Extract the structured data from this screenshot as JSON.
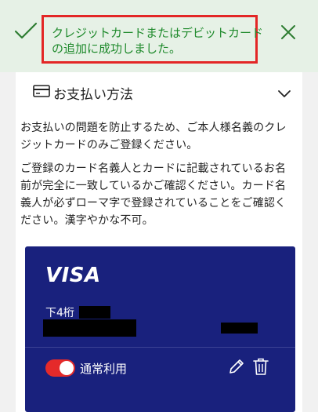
{
  "banner": {
    "line1": "クレジットカードまたはデビットカード",
    "line2": "の追加に成功しました。",
    "icons": {
      "status": "check-icon",
      "dismiss": "close-icon"
    },
    "colors": {
      "background": "#e6f1e6",
      "text": "#1f8a2c",
      "highlight_border": "#e32626"
    }
  },
  "payment": {
    "title": "お支払い方法",
    "icons": {
      "leading": "credit-card-icon",
      "toggle": "chevron-down-icon"
    },
    "notes": [
      "お支払いの問題を防止するため、ご本人様名義のクレ\nジットカードのみご登録ください。",
      "ご登録のカード名義人とカードに記載されているお名\n前が完全に一致しているかご確認ください。カード名\n義人が必ずローマ字で登録されていることをご確認く\nださい。漢字やかな不可。"
    ]
  },
  "card": {
    "brand": "VISA",
    "last4_label": "下4桁",
    "status_label": "通常利用",
    "status_on": true,
    "icons": {
      "edit": "pencil-icon",
      "delete": "trash-icon"
    },
    "colors": {
      "card": "#19217d",
      "toggle": "#e52a2a"
    }
  }
}
